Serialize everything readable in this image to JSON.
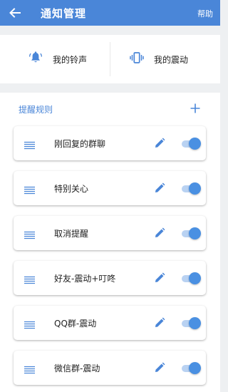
{
  "header": {
    "title": "通知管理",
    "help_label": "帮助",
    "back_icon": "arrow-left-icon",
    "color": "#4a86d8"
  },
  "sound_settings": {
    "ringtone_label": "我的铃声",
    "ringtone_icon": "bell-icon",
    "vibration_label": "我的震动",
    "vibration_icon": "vibrate-icon"
  },
  "rules": {
    "section_title": "提醒规则",
    "add_icon": "plus-icon",
    "items": [
      {
        "name": "刚回复的群聊",
        "enabled": true
      },
      {
        "name": "特别关心",
        "enabled": true
      },
      {
        "name": "取消提醒",
        "enabled": true
      },
      {
        "name": "好友-震动+叮咚",
        "enabled": true
      },
      {
        "name": "QQ群-震动",
        "enabled": true
      },
      {
        "name": "微信群-震动",
        "enabled": true
      }
    ]
  },
  "colors": {
    "accent": "#4a86d8",
    "toggle_on": "#4a90e2",
    "toggle_track": "#b9d2f2",
    "background": "#eef0f2"
  }
}
